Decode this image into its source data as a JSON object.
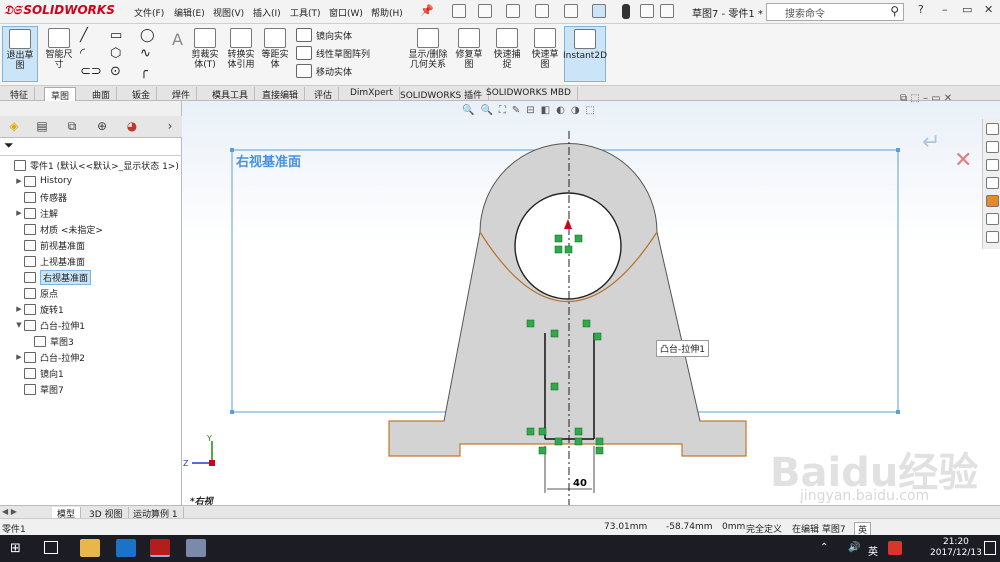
{
  "app": {
    "logo": "SOLIDWORKS",
    "doc_title": "草图7 - 零件1 *"
  },
  "menu": [
    "文件(F)",
    "编辑(E)",
    "视图(V)",
    "插入(I)",
    "工具(T)",
    "窗口(W)",
    "帮助(H)"
  ],
  "search": {
    "placeholder": "搜索命令"
  },
  "ribbon": {
    "exit_sketch": "退出草图",
    "smart_dim": "智能尺寸",
    "trim": "剪裁实体(T)",
    "convert": "转换实体引用",
    "offset": "等距实体",
    "mirror": "镜向实体",
    "linear_pattern": "线性草图阵列",
    "move": "移动实体",
    "display_relations": "显示/删除几何关系",
    "repair": "修复草图",
    "quick_snap": "快速捕捉",
    "rapid_sketch": "快速草图",
    "instant2d": "Instant2D"
  },
  "tabs": [
    "特征",
    "草图",
    "曲面",
    "钣金",
    "焊件",
    "模具工具",
    "直接编辑",
    "评估",
    "DimXpert",
    "SOLIDWORKS 插件",
    "SOLIDWORKS MBD"
  ],
  "tree": [
    {
      "label": "零件1 (默认<<默认>_显示状态 1>)",
      "indent": 0,
      "exp": ""
    },
    {
      "label": "History",
      "indent": 1,
      "exp": "▶"
    },
    {
      "label": "传感器",
      "indent": 1,
      "exp": ""
    },
    {
      "label": "注解",
      "indent": 1,
      "exp": "▶"
    },
    {
      "label": "材质 <未指定>",
      "indent": 1,
      "exp": ""
    },
    {
      "label": "前视基准面",
      "indent": 1,
      "exp": ""
    },
    {
      "label": "上视基准面",
      "indent": 1,
      "exp": ""
    },
    {
      "label": "右视基准面",
      "indent": 1,
      "exp": "",
      "selected": true
    },
    {
      "label": "原点",
      "indent": 1,
      "exp": ""
    },
    {
      "label": "旋转1",
      "indent": 1,
      "exp": "▶"
    },
    {
      "label": "凸台-拉伸1",
      "indent": 1,
      "exp": "▼"
    },
    {
      "label": "草图3",
      "indent": 2,
      "exp": ""
    },
    {
      "label": "凸台-拉伸2",
      "indent": 1,
      "exp": "▶"
    },
    {
      "label": "镜向1",
      "indent": 1,
      "exp": ""
    },
    {
      "label": "草图7",
      "indent": 1,
      "exp": ""
    }
  ],
  "graphics": {
    "plane_label": "右视基准面",
    "view_name": "*右视",
    "tooltip": "凸台-拉伸1",
    "dimension": "40",
    "axis_y": "Y",
    "axis_z": "Z"
  },
  "bottom_tabs": [
    "模型",
    "3D 视图",
    "运动算例 1"
  ],
  "status": {
    "part": "零件1",
    "x": "73.01mm",
    "y": "-58.74mm",
    "z": "0mm",
    "state": "完全定义",
    "editing": "在编辑 草图7",
    "ime": "英"
  },
  "taskbar": {
    "time": "21:20",
    "date": "2017/12/13",
    "ime": "英"
  },
  "watermark": {
    "main": "Baidu经验",
    "sub": "jingyan.baidu.com"
  }
}
